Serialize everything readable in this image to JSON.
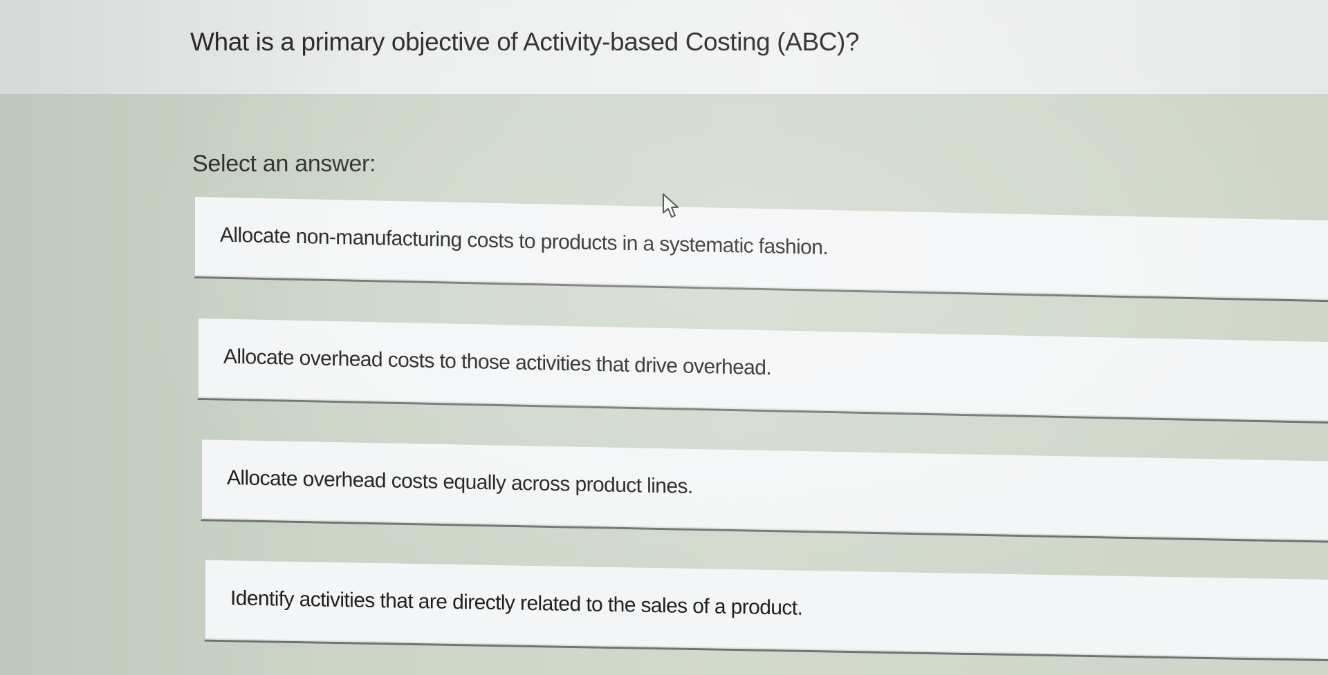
{
  "quiz": {
    "question": "What is a primary objective of Activity-based Costing (ABC)?",
    "prompt": "Select an answer:",
    "options": [
      {
        "label": "Allocate non-manufacturing costs to products in a systematic fashion."
      },
      {
        "label": "Allocate overhead costs to those activities that drive overhead."
      },
      {
        "label": "Allocate overhead costs equally across product lines."
      },
      {
        "label": "Identify activities that are directly related to the sales of a product."
      }
    ]
  },
  "icons": {
    "cursor": "mouse-pointer-icon"
  },
  "colors": {
    "header_bg": "#eceeee",
    "body_bg": "#ccd4c8",
    "option_bg": "#f4f5f6",
    "option_border": "#6e7470",
    "text": "#1f1f1f"
  }
}
